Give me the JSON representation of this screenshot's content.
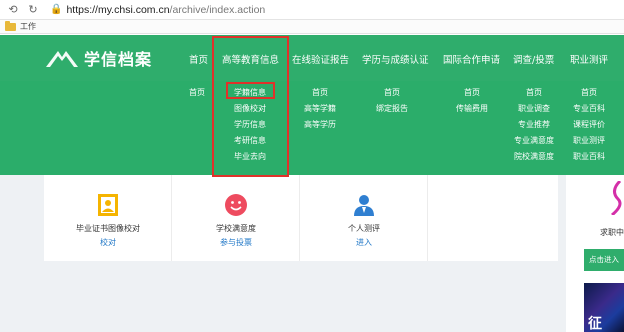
{
  "browser": {
    "secure_icon": "lock-icon",
    "url_prefix": "https://",
    "url_host": "my.chsi.com.cn",
    "url_path": "/archive/index.action",
    "bookmark": "工作"
  },
  "header": {
    "logo_text": "学信档案",
    "nav": [
      "首页",
      "高等教育信息",
      "在线验证报告",
      "学历与成绩认证",
      "国际合作申请",
      "调查/投票",
      "职业测评"
    ]
  },
  "dropdown": {
    "col_home": [
      "首页"
    ],
    "col_higher_ed": [
      "学籍信息",
      "图像校对",
      "学历信息",
      "考研信息",
      "毕业去向"
    ],
    "col_verify": [
      "首页",
      "高等学籍",
      "高等学历"
    ],
    "col_cert": [
      "首页",
      "绑定报告"
    ],
    "col_intl": [
      "首页",
      "传输费用"
    ],
    "col_survey": [
      "首页",
      "职业调查",
      "专业推荐",
      "专业满意度",
      "院校满意度"
    ],
    "col_career": [
      "首页",
      "专业百科",
      "课程评价",
      "职业测评",
      "职业百科"
    ]
  },
  "cards": [
    {
      "title": "毕业证书图像校对",
      "link": "校对",
      "icon": "id-photo-icon"
    },
    {
      "title": "学校满意度",
      "link": "参与投票",
      "icon": "smiley-icon"
    },
    {
      "title": "个人测评",
      "link": "进入",
      "icon": "person-icon"
    }
  ],
  "promo": {
    "text": "求职中",
    "button": "点击进入",
    "image_text": "征"
  },
  "colors": {
    "brand_green": "#2fad6c",
    "highlight_red": "#e0322a",
    "link_blue": "#2278c7"
  }
}
